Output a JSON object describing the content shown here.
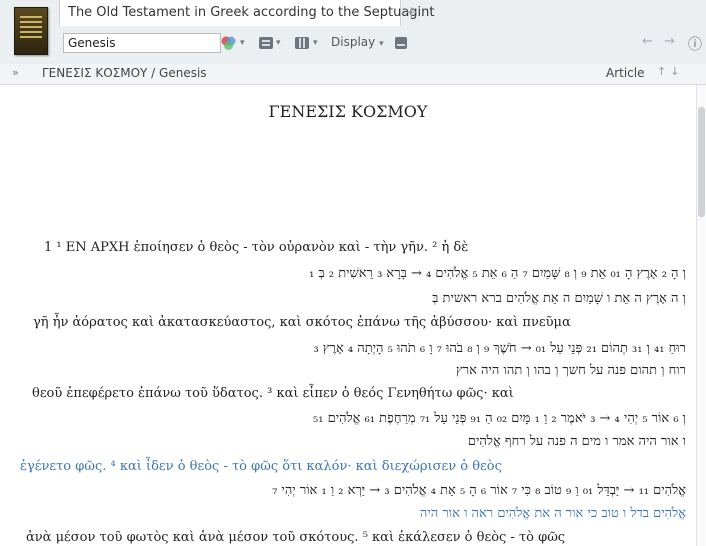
{
  "window": {
    "tab_title": "The Old Testament in Greek according to the Septuagint",
    "tab_add": "+"
  },
  "toolbar": {
    "reference": "Genesis",
    "display_label": "Display",
    "nav_back": "←",
    "nav_forward": "→",
    "info": "ⓘ"
  },
  "breadcrumb": {
    "chevron": "»",
    "path": "ΓΕΝΕΣΙΣ ΚΟΣΜΟΥ / Genesis",
    "article": "Article",
    "arrows": "↑↓"
  },
  "document": {
    "title": "ΓΕΝΕΣΙΣ ΚΟΣΜΟΥ",
    "lines": [
      "1 ¹ ΕΝ ΑΡΧΗ ἐποίησεν ὁ θεὸς - τὸν οὐρανὸν καὶ - τὴν γῆν. ² ἡ δὲ",
      "וְ הָ ₂ אָרֶץ הָ ₁₀ אֵת ₉ וְ ₈ שָּׁמַיִם ₇ הַ ₆ אֵת ₅ אֱלֹהִים ₄ → בָּרָא ₃ רֵאשִׁית ₂ בְּ ₁",
      "וְ ה אָרֶץ ה אֵת ו שָׁמַיִם ה אֵת אֱלֹהִים ברא ראשית בְּ",
      "γῆ ἦν ἀόρατος καὶ ἀκατασκεύαστος, καὶ σκότος ἐπάνω τῆς ἀβύσσου· καὶ πνεῦμα",
      "רוּחַ ₁₄ וְ ₁₃ תְהוֹם ₁₂ פְּנֵי עַל ₁₀ → חֹשֶׁךְ ₉ וְ ₈ בֹהוּ ₇ וָ ₆ תֹהוּ ₅ הָיְתָה ₄ אָרֶץ ₃",
      "רוח וְ תהום פנה על חשך וְ בהו וְ תהו היה ארץ",
      "θεοῦ ἐπεφέρετο ἐπάνω τοῦ ὕδατος. ³ καὶ εἶπεν ὁ θεός Γενηθήτω φῶς· καὶ",
      "וְ ₆ אוֹר ₅ יְהִי ₄ → ₃ יֹּאמֶר ₂ וַ ₁ מָּיִם ₂₀ הַ ₁₉ פְּנֵי עַל ₁₇ מְרַחֶפֶת ₁₆ אֱלֹהִים ₁₅",
      "ו אור היה אמר ו מים ה פנה על רחף אֱלֹהִים",
      "ἐγένετο φῶς. ⁴ καὶ ἶδεν ὁ θεὸς - τὸ φῶς ὅτι καλόν· καὶ διεχώρισεν ὁ θεὸς",
      "אֱלֹהִים ₁₁ → יַּבְדֵּל ₁₀ וַ ₉ טוֹב ₈ כִּי ₇ אוֹר ₆ הָ ₅ אֵת ₄ אֱלֹהִים ₃ → יַּרְא ₂ וַ ₁ אוֹר יְהִי ₇",
      "אֱלֹהִים בדל ו טוב כי אור ה את אֱלֹהִים ראה ו אור היה",
      "ἀνὰ μέσον τοῦ φωτὸς καὶ ἀνὰ μέσον τοῦ σκότους. ⁵ καὶ ἐκάλεσεν ὁ θεὸς - τὸ φῶς"
    ]
  },
  "colors": {
    "accent": "#3a76b5",
    "brown": "#a35a2a",
    "bubble": "#3aa35a",
    "dot": "#8a3fd0"
  }
}
